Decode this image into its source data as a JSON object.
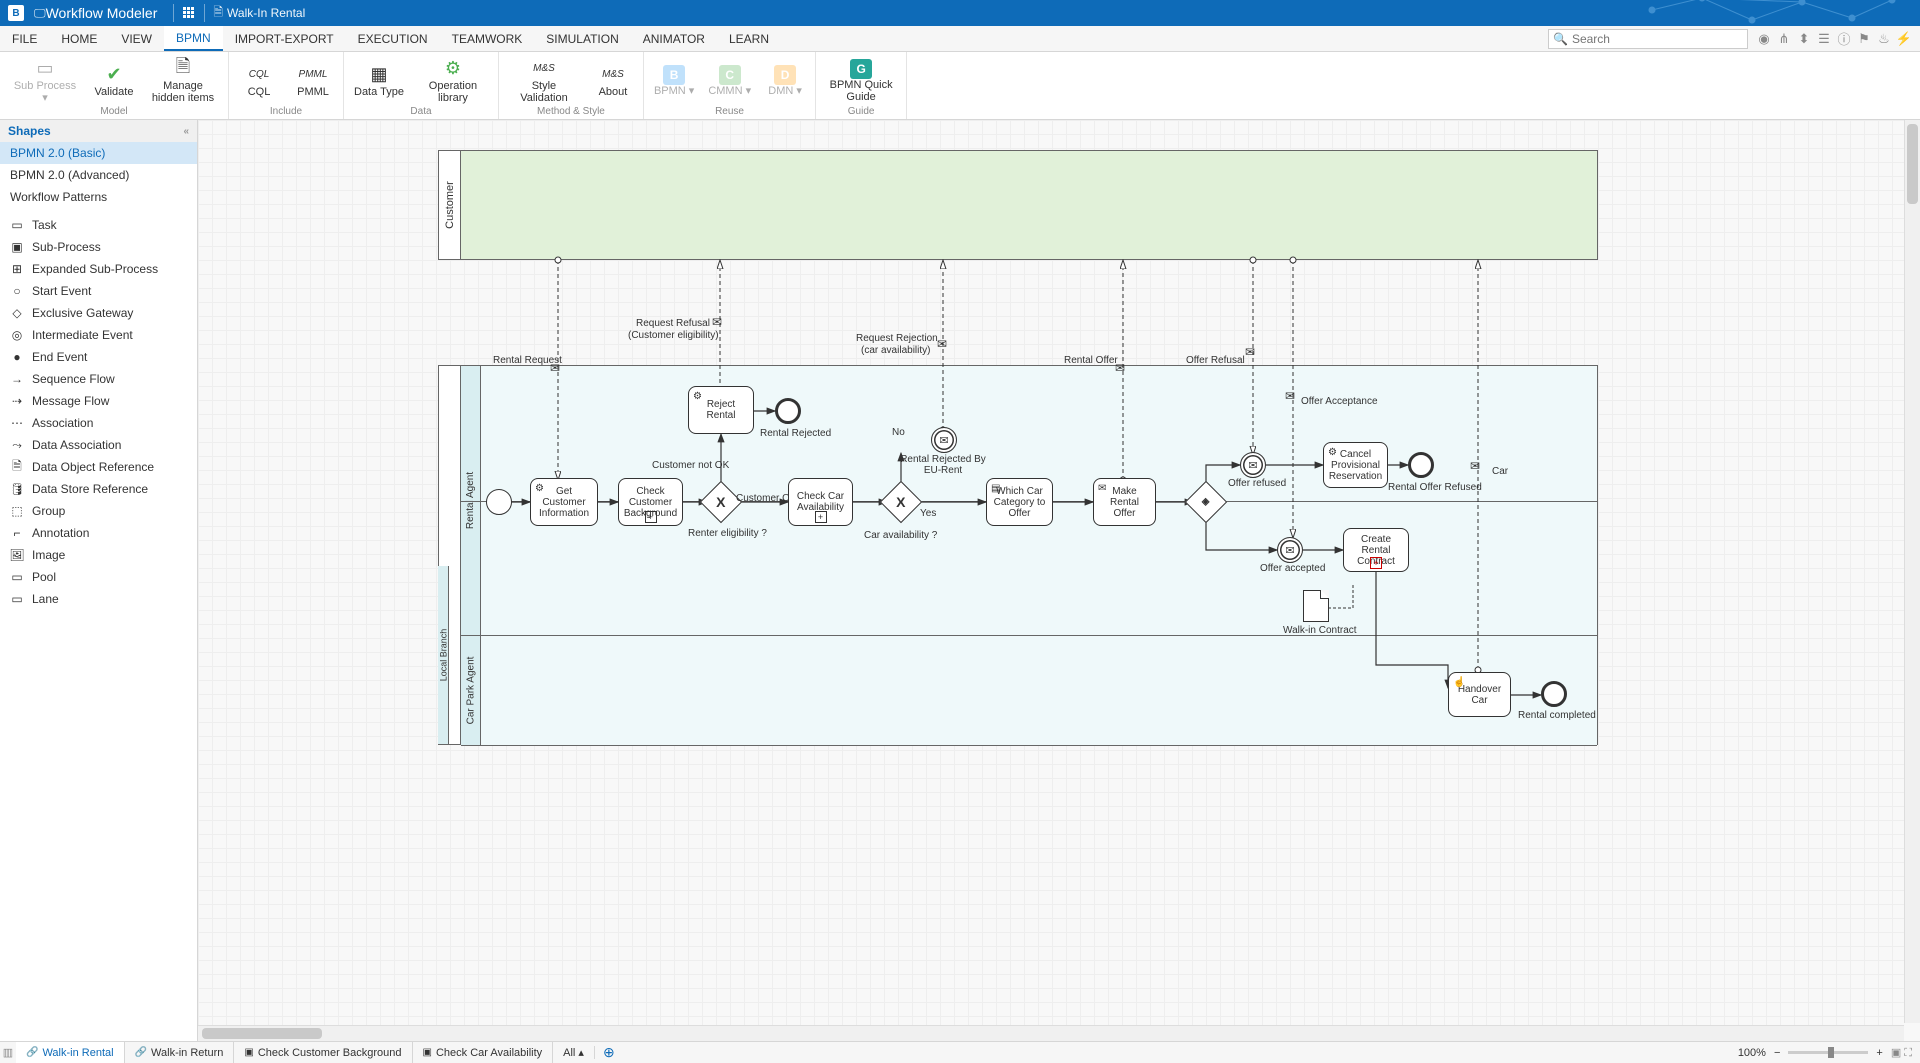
{
  "app": {
    "name": "Workflow Modeler",
    "doc_name": "Walk-In Rental"
  },
  "menu": {
    "items": [
      "FILE",
      "HOME",
      "VIEW",
      "BPMN",
      "IMPORT-EXPORT",
      "EXECUTION",
      "TEAMWORK",
      "SIMULATION",
      "ANIMATOR",
      "LEARN"
    ],
    "active": "BPMN",
    "search_placeholder": "Search"
  },
  "ribbon": {
    "groups": [
      {
        "label": "Model",
        "items": [
          {
            "id": "sub-process",
            "label": "Sub Process ▾",
            "disabled": true
          },
          {
            "id": "validate",
            "label": "Validate"
          },
          {
            "id": "manage-hidden",
            "label": "Manage hidden items"
          }
        ]
      },
      {
        "label": "Include",
        "items": [
          {
            "id": "cql",
            "label": "CQL"
          },
          {
            "id": "pmml",
            "label": "PMML"
          }
        ]
      },
      {
        "label": "Data",
        "items": [
          {
            "id": "data-type",
            "label": "Data Type"
          },
          {
            "id": "operation-library",
            "label": "Operation library"
          }
        ]
      },
      {
        "label": "Method & Style",
        "items": [
          {
            "id": "style-validation",
            "label": "Style Validation"
          },
          {
            "id": "about",
            "label": "About"
          }
        ]
      },
      {
        "label": "Reuse",
        "items": [
          {
            "id": "bpmn",
            "label": "BPMN ▾",
            "disabled": true
          },
          {
            "id": "cmmn",
            "label": "CMMN ▾",
            "disabled": true
          },
          {
            "id": "dmn",
            "label": "DMN ▾",
            "disabled": true
          }
        ]
      },
      {
        "label": "Guide",
        "items": [
          {
            "id": "bpmn-quick-guide",
            "label": "BPMN Quick Guide"
          }
        ]
      }
    ]
  },
  "sidebar": {
    "header": "Shapes",
    "categories": [
      {
        "label": "BPMN 2.0 (Basic)",
        "active": true
      },
      {
        "label": "BPMN 2.0 (Advanced)"
      },
      {
        "label": "Workflow Patterns"
      }
    ],
    "shapes": [
      "Task",
      "Sub-Process",
      "Expanded Sub-Process",
      "Start Event",
      "Exclusive Gateway",
      "Intermediate Event",
      "End Event",
      "Sequence Flow",
      "Message Flow",
      "Association",
      "Data Association",
      "Data Object Reference",
      "Data Store Reference",
      "Group",
      "Annotation",
      "Image",
      "Pool",
      "Lane"
    ]
  },
  "diagram": {
    "pool_customer": "Customer",
    "lane_rental_agent": "Rental Agent",
    "lane_local_branch": "Local Branch",
    "lane_car_park_agent": "Car Park Agent",
    "msg_rental_request": "Rental Request",
    "msg_request_refusal_l1": "Request Refusal",
    "msg_request_refusal_l2": "(Customer eligibility)",
    "msg_request_rejection_l1": "Request Rejection",
    "msg_request_rejection_l2": "(car availability)",
    "msg_rental_offer": "Rental Offer",
    "msg_offer_refusal": "Offer Refusal",
    "msg_offer_acceptance": "Offer Acceptance",
    "msg_car": "Car",
    "task_get_customer_info": "Get Customer Information",
    "task_check_background": "Check Customer Background",
    "task_reject_rental": "Reject Rental",
    "task_check_car_avail": "Check Car Availability",
    "task_which_car": "Which Car Category to Offer",
    "task_make_offer": "Make Rental Offer",
    "task_cancel_reservation": "Cancel Provisional Reservation",
    "task_create_contract": "Create Rental Contract",
    "task_handover": "Handover Car",
    "end_rental_rejected": "Rental Rejected",
    "end_rental_rejected_eu": "Rental Rejected By EU-Rent",
    "end_offer_refused": "Rental  Offer  Refused",
    "end_rental_completed": "Rental  completed",
    "evt_offer_refused": "Offer refused",
    "evt_offer_accepted": "Offer accepted",
    "gw_renter": "Renter eligibility ?",
    "gw_customer_ok": "Customer OK",
    "gw_customer_not_ok": "Customer not OK",
    "gw_car_avail": "Car  availability ?",
    "gw_no": "No",
    "gw_yes": "Yes",
    "data_walkin_contract": "Walk-in Contract"
  },
  "tabs": {
    "items": [
      {
        "label": "Walk-in Rental",
        "active": true,
        "icon": "link"
      },
      {
        "label": "Walk-in Return",
        "icon": "link"
      },
      {
        "label": "Check Customer Background",
        "icon": "sub"
      },
      {
        "label": "Check Car Availability",
        "icon": "sub"
      }
    ],
    "all": "All ▴",
    "zoom": "100%"
  }
}
